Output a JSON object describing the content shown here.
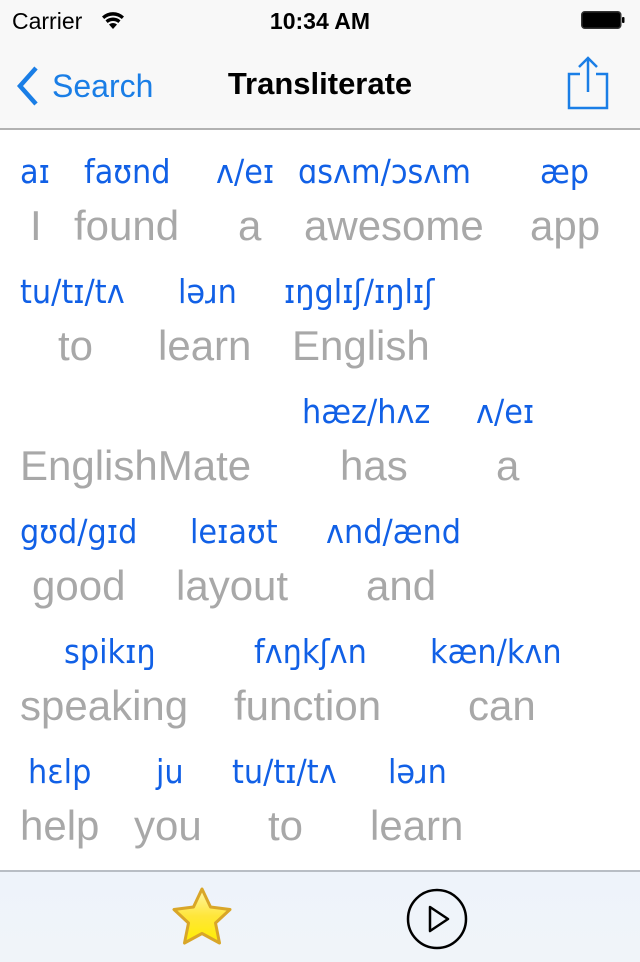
{
  "status_bar": {
    "carrier": "Carrier",
    "time": "10:34 AM",
    "wifi_icon": "wifi-icon",
    "battery_icon": "battery-full-icon"
  },
  "nav_bar": {
    "back_label": "Search",
    "back_icon": "chevron-left-icon",
    "title": "Transliterate",
    "share_icon": "share-icon",
    "accent_color": "#1a7ee6"
  },
  "transliteration": {
    "ipa_color": "#1160e6",
    "text_color": "#a8a8a8",
    "lines": [
      {
        "words": [
          {
            "ipa": "aɪ",
            "text": "I"
          },
          {
            "ipa": "faʊnd",
            "text": "found"
          },
          {
            "ipa": "ʌ/eɪ",
            "text": "a"
          },
          {
            "ipa": "ɑsʌm/ɔsʌm",
            "text": "awesome"
          },
          {
            "ipa": "æp",
            "text": "app"
          }
        ]
      },
      {
        "words": [
          {
            "ipa": "tu/tɪ/tʌ",
            "text": "to"
          },
          {
            "ipa": "ləɹn",
            "text": "learn"
          },
          {
            "ipa": "ɪŋglɪʃ/ɪŋlɪʃ",
            "text": "English"
          }
        ]
      },
      {
        "words": [
          {
            "ipa": "",
            "text": "EnglishMate"
          },
          {
            "ipa": "hæz/hʌz",
            "text": "has"
          },
          {
            "ipa": "ʌ/eɪ",
            "text": "a"
          }
        ]
      },
      {
        "words": [
          {
            "ipa": "gʊd/gɪd",
            "text": "good"
          },
          {
            "ipa": "leɪaʊt",
            "text": "layout"
          },
          {
            "ipa": "ʌnd/ænd",
            "text": "and"
          }
        ]
      },
      {
        "words": [
          {
            "ipa": "spikɪŋ",
            "text": "speaking"
          },
          {
            "ipa": "fʌŋkʃʌn",
            "text": "function"
          },
          {
            "ipa": "kæn/kʌn",
            "text": "can"
          }
        ]
      },
      {
        "words": [
          {
            "ipa": "hɛlp",
            "text": "help"
          },
          {
            "ipa": "ju",
            "text": "you"
          },
          {
            "ipa": "tu/tɪ/tʌ",
            "text": "to"
          },
          {
            "ipa": "ləɹn",
            "text": "learn"
          }
        ]
      }
    ]
  },
  "toolbar": {
    "favorite_icon": "star-icon",
    "play_icon": "play-circle-icon"
  }
}
